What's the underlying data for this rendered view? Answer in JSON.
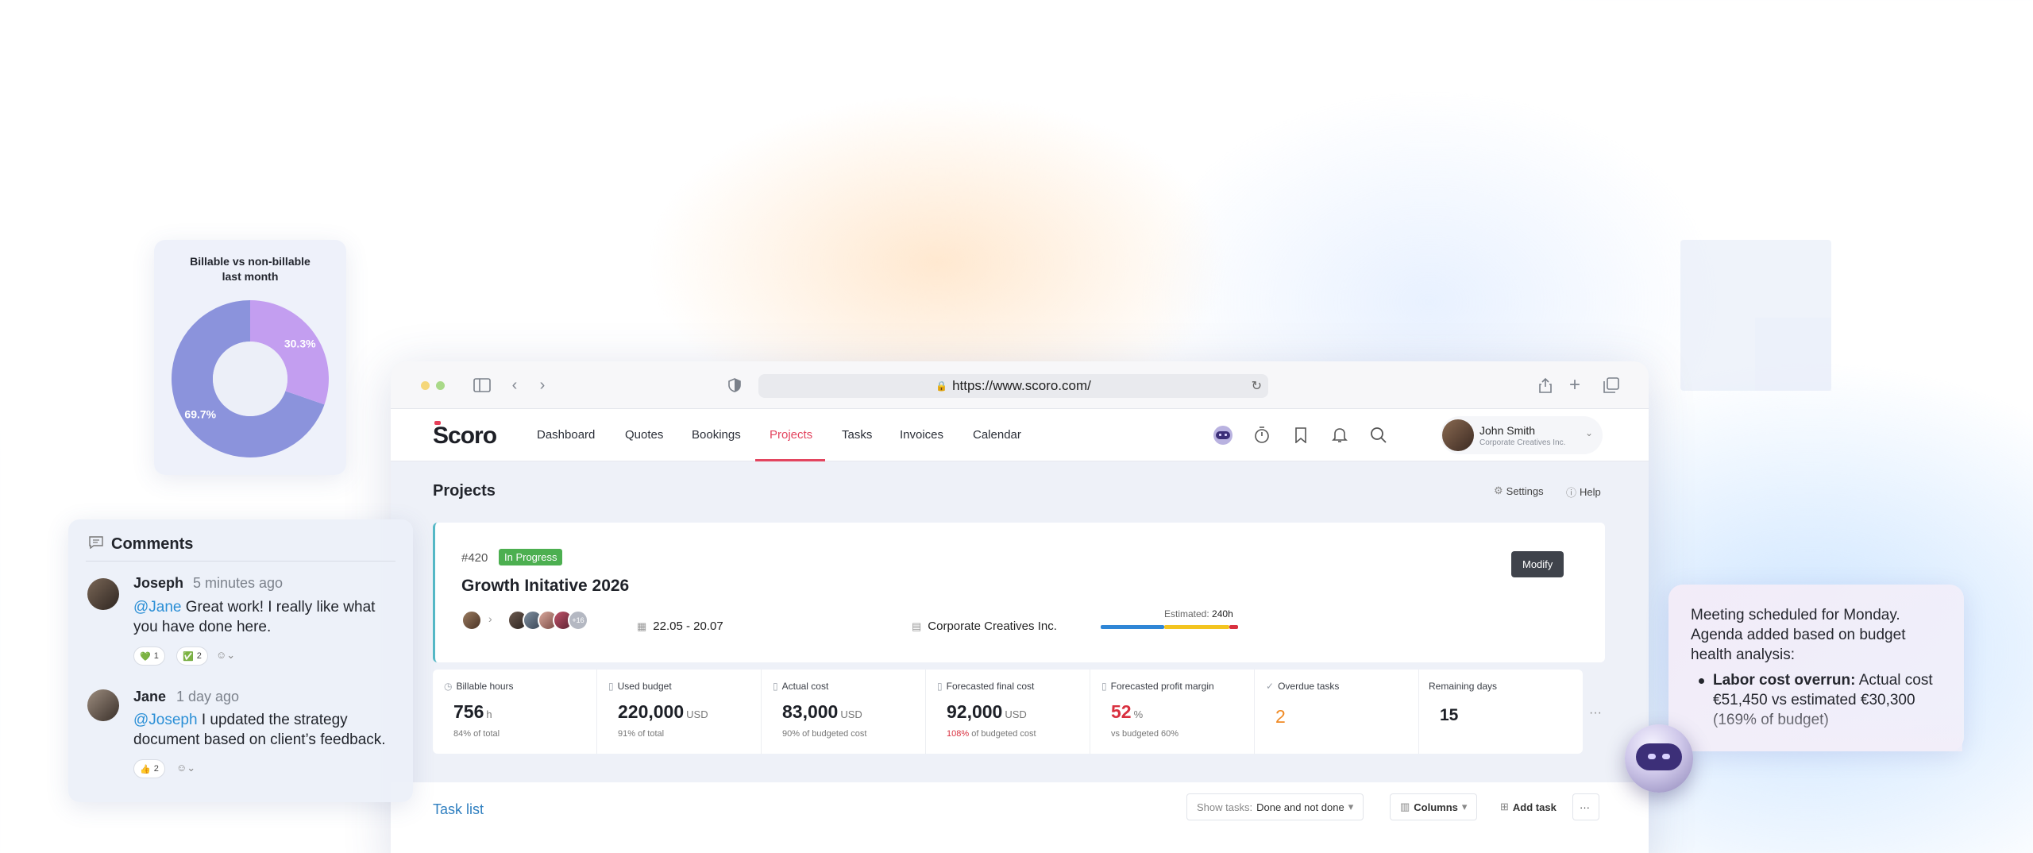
{
  "browser": {
    "url": "https://www.scoro.com/"
  },
  "app": {
    "logo": "Scoro",
    "nav": [
      {
        "label": "Dashboard"
      },
      {
        "label": "Quotes"
      },
      {
        "label": "Bookings"
      },
      {
        "label": "Projects"
      },
      {
        "label": "Tasks"
      },
      {
        "label": "Invoices"
      },
      {
        "label": "Calendar"
      }
    ],
    "active_nav": "Projects",
    "user": {
      "name": "John Smith",
      "org": "Corporate Creatives Inc."
    },
    "accent_color": "#e3455f"
  },
  "page": {
    "title": "Projects",
    "settings_label": "Settings",
    "help_label": "Help"
  },
  "project": {
    "number": "#420",
    "status": "In Progress",
    "status_color": "#4caf50",
    "title": "Growth Initative 2026",
    "modify_label": "Modify",
    "extra_members": "+16",
    "dates": "22.05 - 20.07",
    "client": "Corporate Creatives Inc.",
    "estimated_label": "Estimated:",
    "estimated_value": "240h"
  },
  "stats": [
    {
      "label": "Billable hours",
      "value": "756",
      "unit": "h",
      "sub": "84% of total",
      "sub_highlight": ""
    },
    {
      "label": "Used budget",
      "value": "220,000",
      "unit": "USD",
      "sub": "91% of total",
      "sub_highlight": ""
    },
    {
      "label": "Actual cost",
      "value": "83,000",
      "unit": "USD",
      "sub": "90% of budgeted cost",
      "sub_highlight": ""
    },
    {
      "label": "Forecasted final cost",
      "value": "92,000",
      "unit": "USD",
      "sub": "of budgeted cost",
      "sub_highlight": "108%"
    },
    {
      "label": "Forecasted profit margin",
      "value": "52",
      "unit": "%",
      "sub": "vs budgeted 60%",
      "sub_highlight": ""
    },
    {
      "label": "Overdue tasks",
      "value": "2",
      "unit": "",
      "sub": "",
      "sub_highlight": ""
    },
    {
      "label": "Remaining days",
      "value": "15",
      "unit": "",
      "sub": "",
      "sub_highlight": ""
    }
  ],
  "tasks": {
    "title": "Task list",
    "show_label": "Show tasks:",
    "show_value": "Done and not done",
    "columns_label": "Columns",
    "add_label": "Add task"
  },
  "pie_card": {
    "title_line1": "Billable vs non-billable",
    "title_line2": "last month"
  },
  "chart_data": {
    "type": "pie",
    "title": "Billable vs non-billable last month",
    "values": [
      69.7,
      30.3
    ],
    "labels": [
      "69.7%",
      "30.3%"
    ],
    "colors": [
      "#8b93dc",
      "#c39ef0"
    ]
  },
  "comments": {
    "title": "Comments",
    "items": [
      {
        "author": "Joseph",
        "time": "5 minutes ago",
        "mention": "@Jane",
        "text": " Great work! I really like what you have done here.",
        "reactions": [
          {
            "icon": "💚",
            "count": "1"
          },
          {
            "icon": "✅",
            "count": "2"
          }
        ]
      },
      {
        "author": "Jane",
        "time": "1 day ago",
        "mention": "@Joseph",
        "text": " I updated the strategy document based on client’s feedback.",
        "reactions": [
          {
            "icon": "👍",
            "count": "2"
          }
        ]
      }
    ]
  },
  "ai": {
    "message": "Meeting scheduled for Monday. Agenda added based on budget health analysis:",
    "bullet_bold": "Labor cost overrun:",
    "bullet_text": " Actual cost €51,450 vs estimated €30,300 (169% of budget)"
  }
}
